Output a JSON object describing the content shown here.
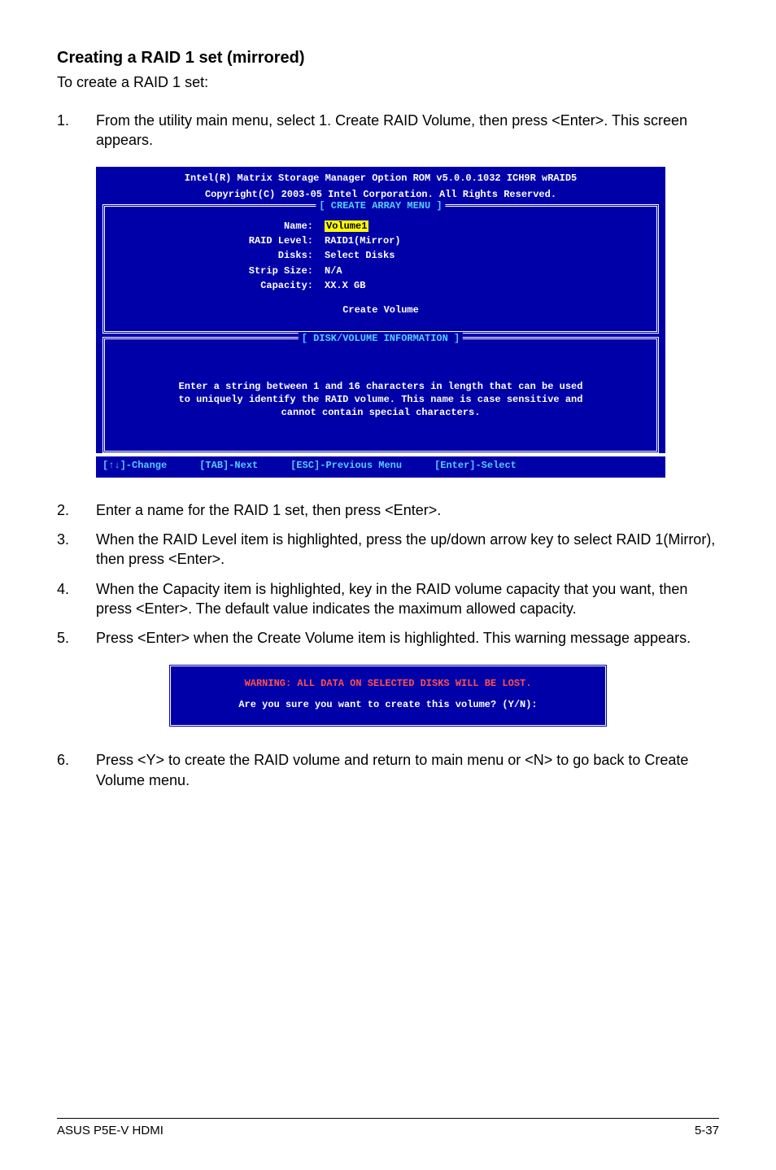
{
  "title": "Creating a RAID 1 set (mirrored)",
  "intro": "To create a RAID 1 set:",
  "step1": {
    "num": "1.",
    "text": "From the utility main menu, select 1. Create RAID Volume, then press <Enter>. This screen appears."
  },
  "bios": {
    "header1": "Intel(R) Matrix Storage Manager Option ROM v5.0.0.1032 ICH9R wRAID5",
    "header2": "Copyright(C) 2003-05 Intel Corporation. All Rights Reserved.",
    "legend1": "[ CREATE ARRAY MENU ]",
    "fields": {
      "name_label": "Name:",
      "name_value": "Volume1",
      "raidlevel_label": "RAID Level:",
      "raidlevel_value": "RAID1(Mirror)",
      "disks_label": "Disks:",
      "disks_value": "Select Disks",
      "strip_label": "Strip Size:",
      "strip_value": "N/A",
      "capacity_label": "Capacity:",
      "capacity_value": "XX.X  GB"
    },
    "create": "Create Volume",
    "legend2": "[ DISK/VOLUME INFORMATION ]",
    "instr1": "Enter a string between 1 and 16 characters in length that can be used",
    "instr2": "to uniquely identify the RAID volume. This name is case sensitive and",
    "instr3": "cannot contain special characters.",
    "footer": {
      "change": "[↑↓]-Change",
      "next": "[TAB]-Next",
      "prev": "[ESC]-Previous Menu",
      "select": "[Enter]-Select"
    }
  },
  "step2": {
    "num": "2.",
    "text": "Enter a name for the RAID 1 set, then press <Enter>."
  },
  "step3": {
    "num": "3.",
    "text": "When the RAID Level item is highlighted, press the up/down arrow key to select RAID 1(Mirror), then press <Enter>."
  },
  "step4": {
    "num": "4.",
    "text": "When the Capacity item is highlighted, key in the RAID volume capacity that you want, then press <Enter>. The default value indicates the maximum allowed capacity."
  },
  "step5": {
    "num": "5.",
    "text": "Press <Enter> when the Create Volume item is highlighted. This warning message appears."
  },
  "warn": {
    "line1": "WARNING: ALL DATA ON SELECTED DISKS WILL BE LOST.",
    "line2": "Are you sure you want to create this volume? (Y/N):"
  },
  "step6": {
    "num": "6.",
    "text": "Press <Y> to create the RAID volume and return to main menu or <N> to go back to Create Volume menu."
  },
  "footer": {
    "left": "ASUS P5E-V HDMI",
    "right": "5-37"
  }
}
